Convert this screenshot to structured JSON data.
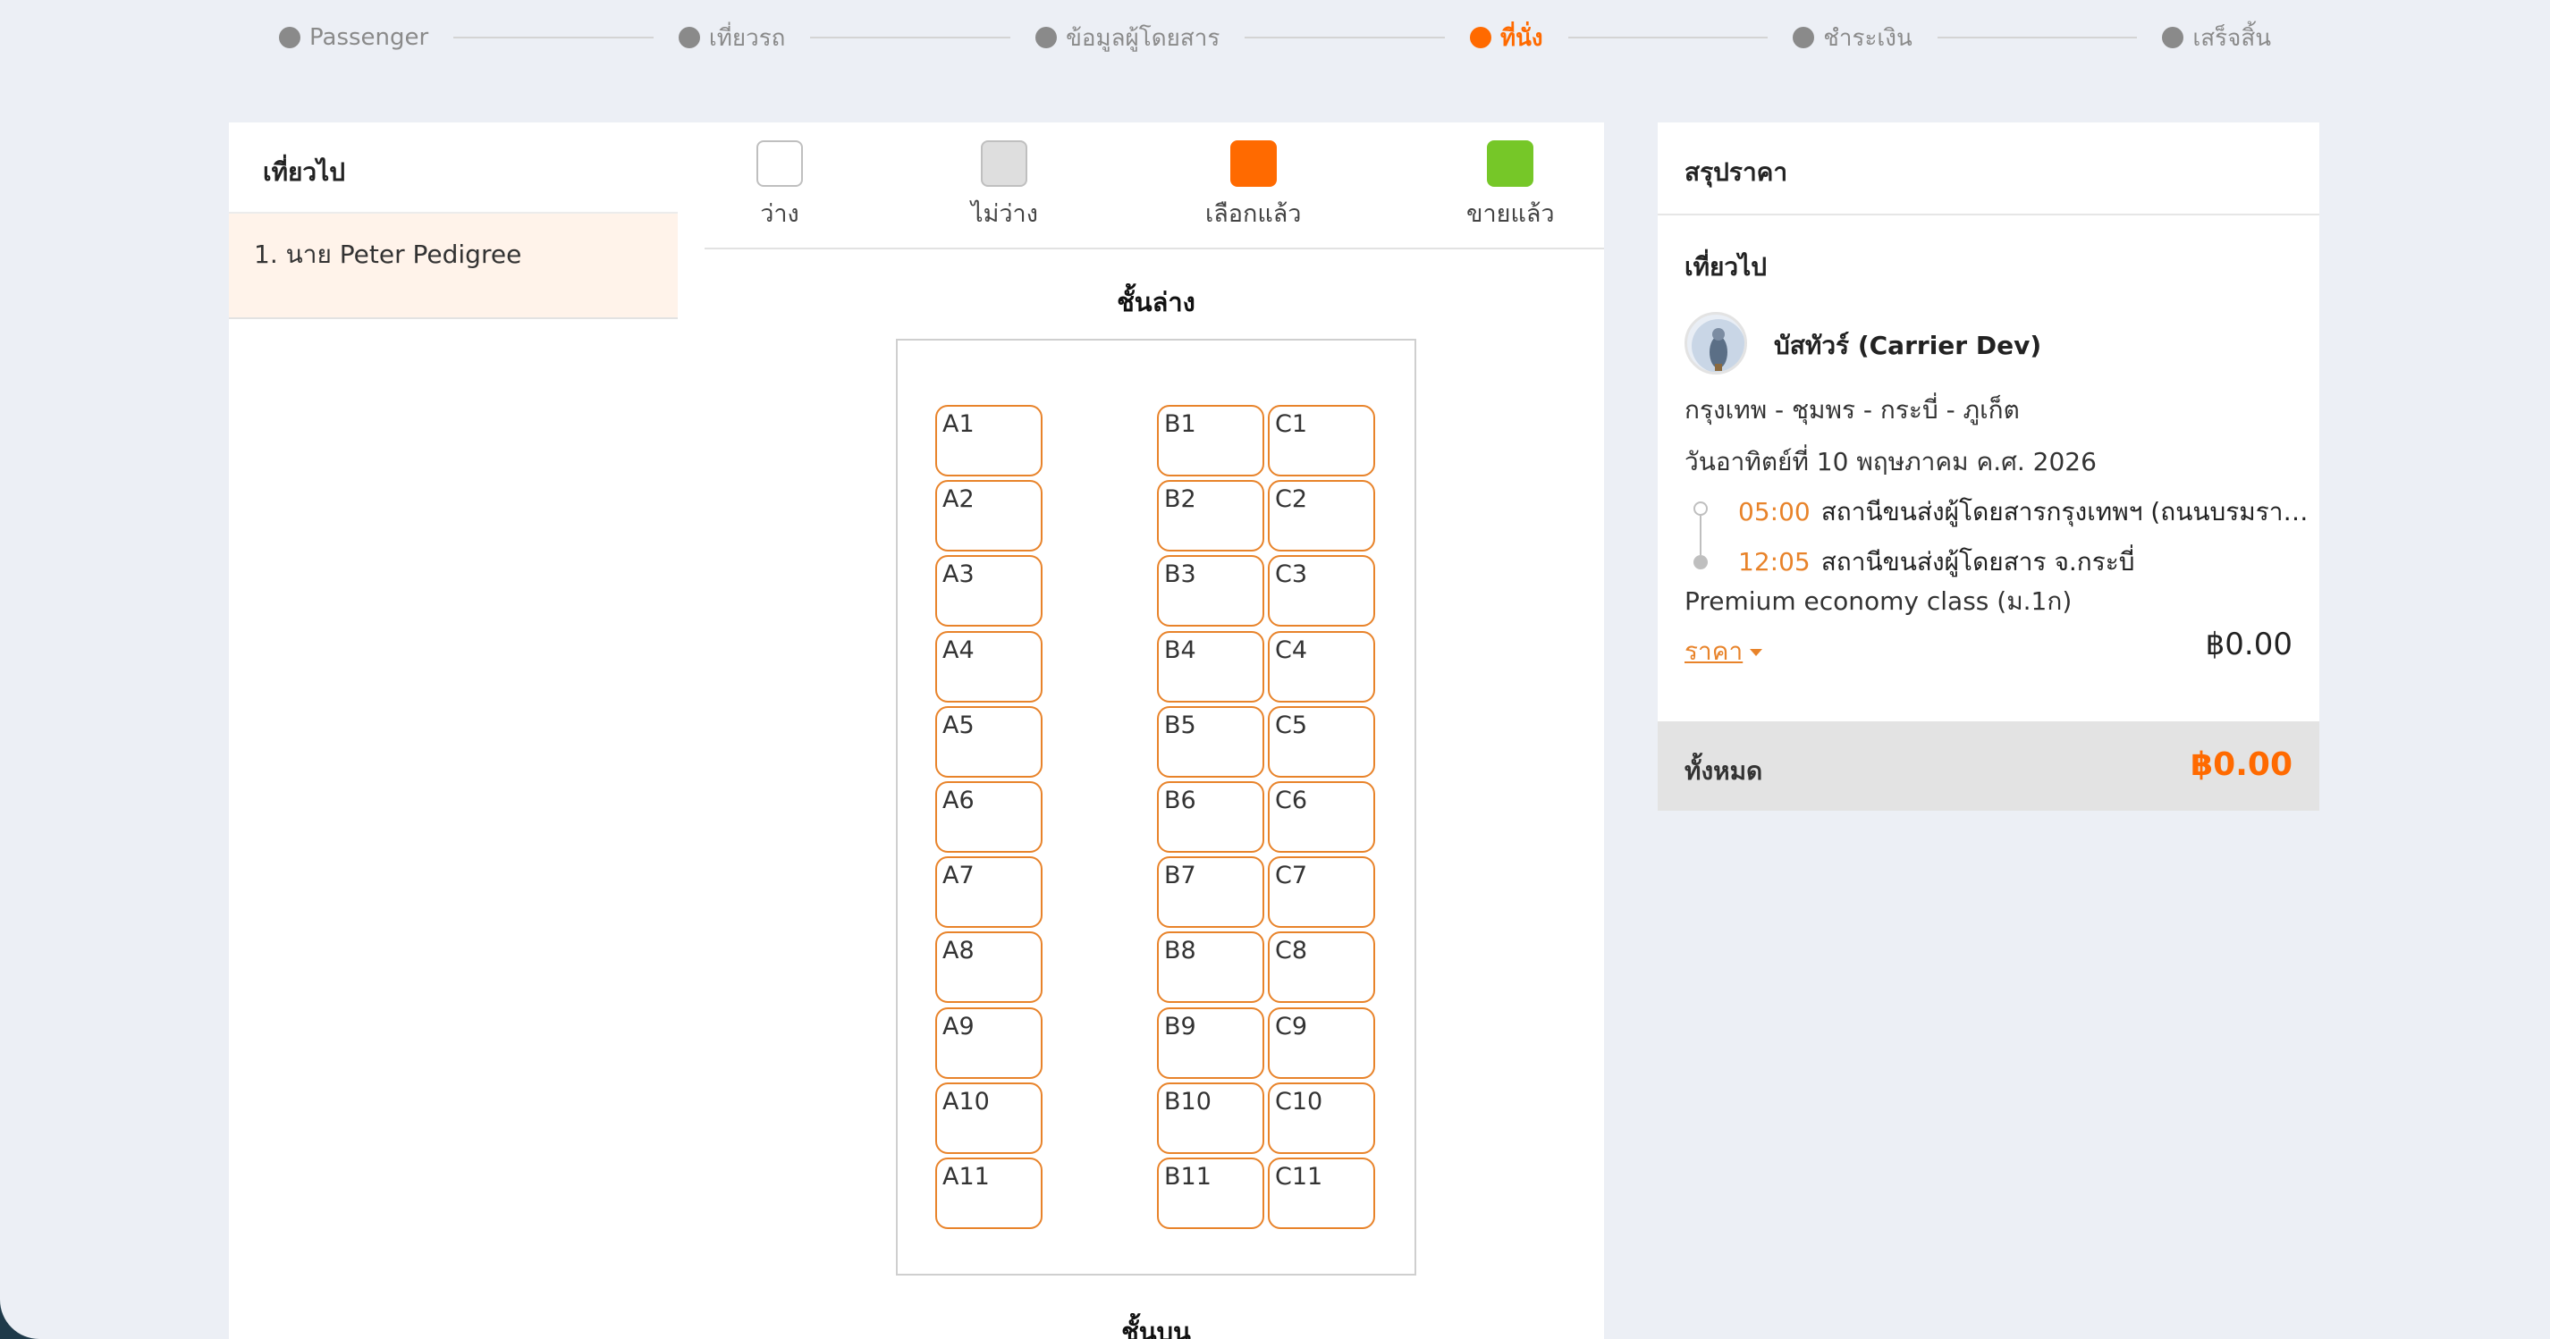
{
  "stepper": {
    "steps": [
      {
        "label": "Passenger",
        "active": false
      },
      {
        "label": "เที่ยวรถ",
        "active": false
      },
      {
        "label": "ข้อมูลผู้โดยสาร",
        "active": false
      },
      {
        "label": "ที่นั่ง",
        "active": true
      },
      {
        "label": "ชำระเงิน",
        "active": false
      },
      {
        "label": "เสร็จสิ้น",
        "active": false
      }
    ]
  },
  "left": {
    "heading": "เที่ยวไป",
    "passenger": "1. นาย Peter Pedigree"
  },
  "legend": [
    {
      "label": "ว่าง",
      "color": "#ffffff",
      "border": "#bfbfbf"
    },
    {
      "label": "ไม่ว่าง",
      "color": "#dedede",
      "border": "#bfbfbf"
    },
    {
      "label": "เลือกแล้ว",
      "color": "#ff6a00",
      "border": "#ff6a00"
    },
    {
      "label": "ขายแล้ว",
      "color": "#76c728",
      "border": "#76c728"
    }
  ],
  "decks": {
    "lower_title": "ชั้นล่าง",
    "upper_title": "ชั้นบน",
    "seats": [
      [
        "A1",
        "B1",
        "C1"
      ],
      [
        "A2",
        "B2",
        "C2"
      ],
      [
        "A3",
        "B3",
        "C3"
      ],
      [
        "A4",
        "B4",
        "C4"
      ],
      [
        "A5",
        "B5",
        "C5"
      ],
      [
        "A6",
        "B6",
        "C6"
      ],
      [
        "A7",
        "B7",
        "C7"
      ],
      [
        "A8",
        "B8",
        "C8"
      ],
      [
        "A9",
        "B9",
        "C9"
      ],
      [
        "A10",
        "B10",
        "C10"
      ],
      [
        "A11",
        "B11",
        "C11"
      ]
    ]
  },
  "summary": {
    "heading": "สรุปราคา",
    "trip_label": "เที่ยวไป",
    "operator": "บัสทัวร์ (Carrier Dev)",
    "route": "กรุงเทพ - ชุมพร - กระบี่ - ภูเก็ต",
    "date": "วันอาทิตย์ที่ 10 พฤษภาคม ค.ศ. 2026",
    "departure_time": "05:00",
    "departure_station": "สถานีขนส่งผู้โดยสารกรุงเทพฯ (ถนนบรมราชช...",
    "arrival_time": "12:05",
    "arrival_station": "สถานีขนส่งผู้โดยสาร จ.กระบี่",
    "seat_class": "Premium economy class (ม.1ก)",
    "price_label": "ราคา",
    "price": "฿0.00",
    "total_label": "ทั้งหมด",
    "total": "฿0.00"
  },
  "colors": {
    "accent": "#ff6a00",
    "seat_border": "#e8832a",
    "background": "#eceff5"
  }
}
